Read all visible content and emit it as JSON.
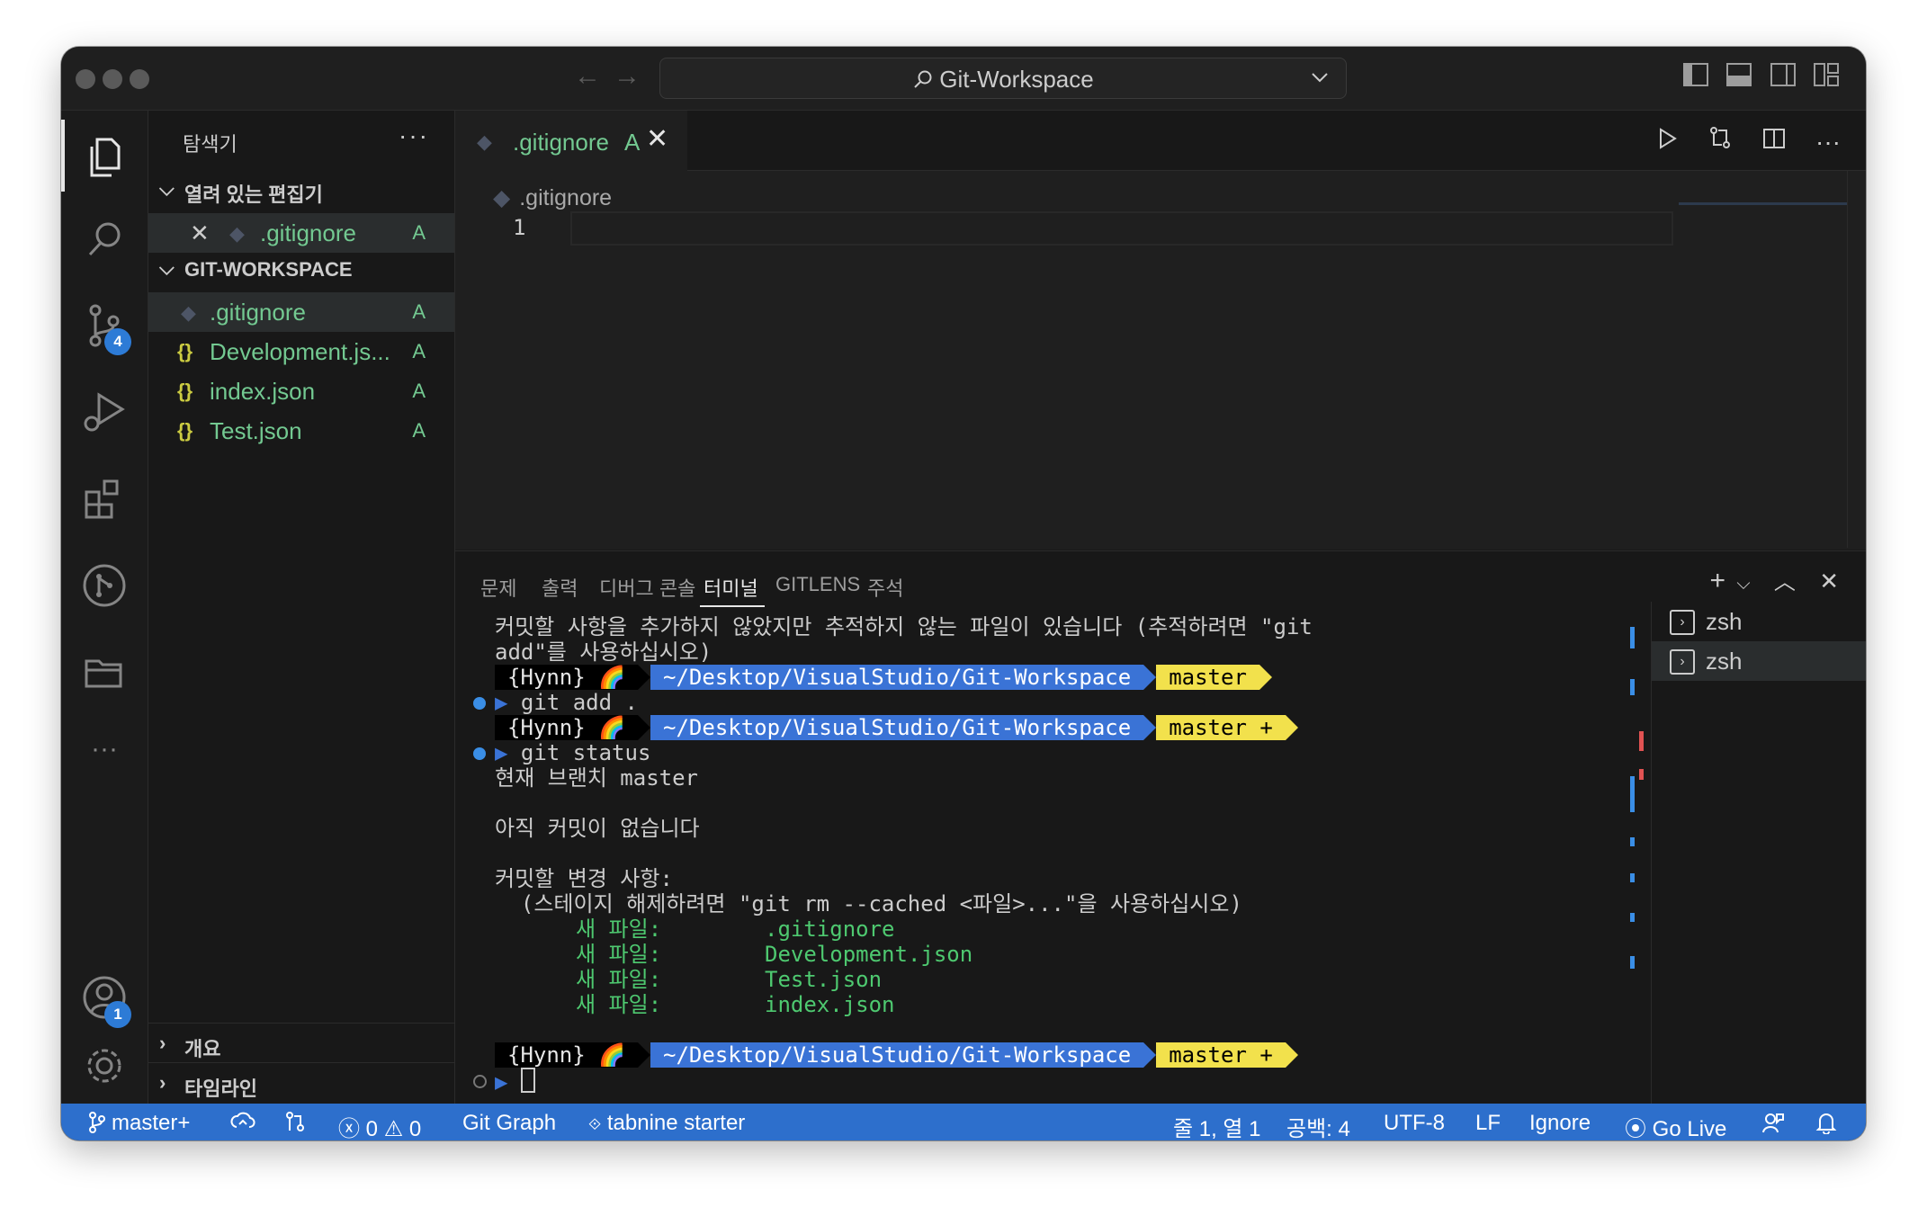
{
  "window": {
    "title": "Git-Workspace"
  },
  "activity_bar": {
    "scm_badge": "4",
    "accounts_badge": "1"
  },
  "sidebar": {
    "title": "탐색기",
    "more": "···",
    "open_editors": {
      "label": "열려 있는 편집기",
      "items": [
        {
          "name": ".gitignore",
          "status": "A"
        }
      ]
    },
    "workspace": {
      "label": "GIT-WORKSPACE",
      "files": [
        {
          "icon": "◆",
          "name": ".gitignore",
          "status": "A"
        },
        {
          "icon": "{}",
          "name": "Development.js...",
          "status": "A"
        },
        {
          "icon": "{}",
          "name": "index.json",
          "status": "A"
        },
        {
          "icon": "{}",
          "name": "Test.json",
          "status": "A"
        }
      ]
    },
    "outline_label": "개요",
    "timeline_label": "타임라인"
  },
  "editor": {
    "tab": {
      "name": ".gitignore",
      "status": "A"
    },
    "breadcrumb": ".gitignore",
    "line_number": "1"
  },
  "panel": {
    "tabs": [
      "문제",
      "출력",
      "디버그 콘솔",
      "터미널",
      "GITLENS",
      "주석"
    ],
    "active_tab": "터미널",
    "terminal": {
      "line1": "커밋할 사항을 추가하지 않았지만 추적하지 않는 파일이 있습니다 (추적하려면 \"git",
      "line2": "add\"를 사용하십시오)",
      "prompt_user": "{Hynn} 🌈",
      "prompt_path": "~/Desktop/VisualStudio/Git-Workspace",
      "prompt_branch": "master",
      "prompt_branch_plus": "master +",
      "cmd1": "git add .",
      "cmd2": "git status",
      "branch_line": "현재 브랜치 master",
      "no_commits": "아직 커밋이 없습니다",
      "changes_header": "커밋할 변경 사항:",
      "unstage_hint": "  (스테이지 해제하려면 \"git rm --cached <파일>...\"을 사용하십시오)",
      "new_file_label": "새 파일:",
      "new_files": [
        ".gitignore",
        "Development.json",
        "Test.json",
        "index.json"
      ]
    },
    "terminal_instances": [
      "zsh",
      "zsh"
    ]
  },
  "status_bar": {
    "branch": "master+",
    "errors": "0",
    "warnings": "0",
    "git_graph": "Git Graph",
    "tabnine": "tabnine starter",
    "position": "줄 1, 열 1",
    "spaces": "공백: 4",
    "encoding": "UTF-8",
    "eol": "LF",
    "ignore": "Ignore",
    "go_live": "Go Live"
  },
  "colors": {
    "accent_blue": "#2d6fcc",
    "git_added_green": "#73c991",
    "prompt_yellow": "#f2e14c",
    "prompt_blue": "#3a73d6"
  }
}
